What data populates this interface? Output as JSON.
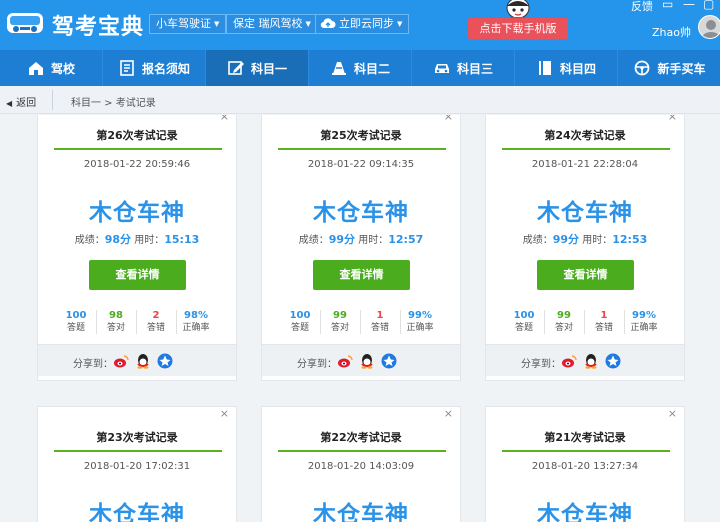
{
  "app": {
    "title": "驾考宝典"
  },
  "header": {
    "license_select": "小车驾驶证",
    "school_select": "保定 瑞风驾校",
    "cloud_sync": "立即云同步",
    "download_button": "点击下载手机版",
    "feedback": "反馈",
    "username": "Zhao帅"
  },
  "nav": {
    "items": [
      {
        "label": "驾校",
        "icon": "school-house-icon"
      },
      {
        "label": "报名须知",
        "icon": "document-icon"
      },
      {
        "label": "科目一",
        "icon": "edit-pencil-icon",
        "active": true
      },
      {
        "label": "科目二",
        "icon": "traffic-cone-icon"
      },
      {
        "label": "科目三",
        "icon": "car-icon"
      },
      {
        "label": "科目四",
        "icon": "book-icon"
      },
      {
        "label": "新手买车",
        "icon": "steering-wheel-icon"
      }
    ]
  },
  "breadcrumb": {
    "back": "返回",
    "path": "科目一 > 考试记录"
  },
  "colors": {
    "primary": "#2495ea",
    "accent_green": "#4bad1e",
    "score_blue": "#2a93e8",
    "wrong_red": "#e94545",
    "download_red": "#e9525a"
  },
  "cards": [
    {
      "title": "第26次考试记录",
      "date": "2018-01-22 20:59:46",
      "rank": "木仓车神",
      "score_label": "成绩：",
      "score": "98分",
      "time_label": "用时：",
      "time": "15:13",
      "detail_button": "查看详情",
      "stats": [
        {
          "value": "100",
          "label": "答题"
        },
        {
          "value": "98",
          "label": "答对"
        },
        {
          "value": "2",
          "label": "答错"
        },
        {
          "value": "98%",
          "label": "正确率"
        }
      ],
      "share_label": "分享到："
    },
    {
      "title": "第25次考试记录",
      "date": "2018-01-22 09:14:35",
      "rank": "木仓车神",
      "score_label": "成绩：",
      "score": "99分",
      "time_label": "用时：",
      "time": "12:57",
      "detail_button": "查看详情",
      "stats": [
        {
          "value": "100",
          "label": "答题"
        },
        {
          "value": "99",
          "label": "答对"
        },
        {
          "value": "1",
          "label": "答错"
        },
        {
          "value": "99%",
          "label": "正确率"
        }
      ],
      "share_label": "分享到："
    },
    {
      "title": "第24次考试记录",
      "date": "2018-01-21 22:28:04",
      "rank": "木仓车神",
      "score_label": "成绩：",
      "score": "99分",
      "time_label": "用时：",
      "time": "12:53",
      "detail_button": "查看详情",
      "stats": [
        {
          "value": "100",
          "label": "答题"
        },
        {
          "value": "99",
          "label": "答对"
        },
        {
          "value": "1",
          "label": "答错"
        },
        {
          "value": "99%",
          "label": "正确率"
        }
      ],
      "share_label": "分享到："
    },
    {
      "title": "第23次考试记录",
      "date": "2018-01-20 17:02:31",
      "rank": "木仓车神"
    },
    {
      "title": "第22次考试记录",
      "date": "2018-01-20 14:03:09",
      "rank": "木仓车神"
    },
    {
      "title": "第21次考试记录",
      "date": "2018-01-20 13:27:34",
      "rank": "木仓车神"
    }
  ]
}
